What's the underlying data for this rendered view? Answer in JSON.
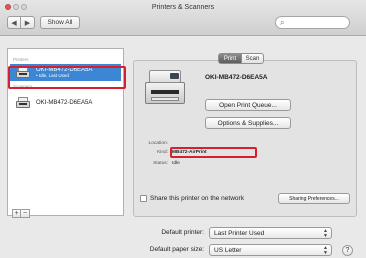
{
  "window": {
    "title": "Printers & Scanners"
  },
  "toolbar": {
    "back": "◀",
    "forward": "▶",
    "show_all": "Show All",
    "search_placeholder": ""
  },
  "sidebar": {
    "group_printers": "Printers",
    "group_scanners": "Scanners",
    "printers": [
      {
        "name": "OKI-MB472-D6EA5A",
        "status": "• Idle, Last Used",
        "selected": true
      },
      {
        "name": "OKI-MB472-D6EA5A",
        "status": "",
        "selected": false
      }
    ],
    "add_label": "+",
    "remove_label": "−"
  },
  "tabs": {
    "print": "Print",
    "scan": "Scan",
    "active": "print"
  },
  "detail": {
    "name": "OKI-MB472-D6EA5A",
    "open_queue": "Open Print Queue...",
    "options_supplies": "Options & Supplies...",
    "location_label": "Location:",
    "location_value": "",
    "kind_label": "Kind:",
    "kind_value": "MB472-AirPrint",
    "status_label": "Status:",
    "status_value": "Idle"
  },
  "sharing": {
    "checkbox_label": "Share this printer on the network",
    "checked": false,
    "preferences_button": "Sharing Preferences..."
  },
  "defaults": {
    "printer_label": "Default printer:",
    "printer_value": "Last Printer Used",
    "paper_label": "Default paper size:",
    "paper_value": "US Letter"
  },
  "help": "?",
  "colors": {
    "highlight": "#d81f2e",
    "selection": "#3d86d4"
  }
}
